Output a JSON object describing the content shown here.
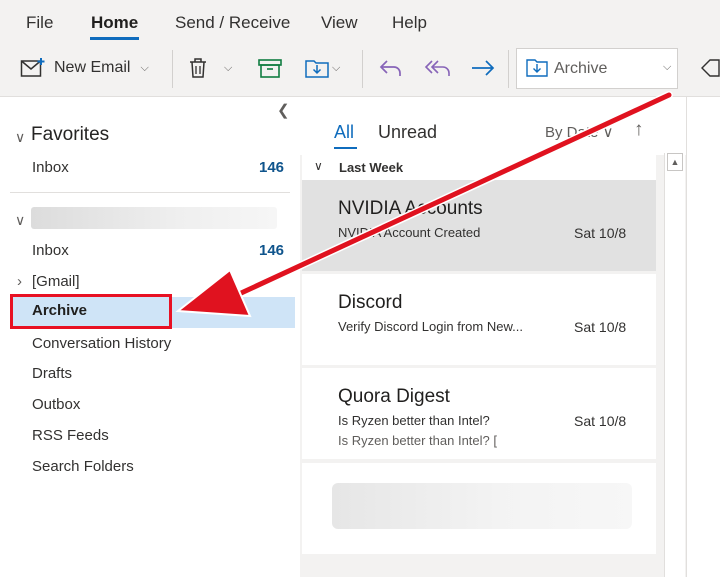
{
  "ribbon": {
    "tabs": [
      {
        "label": "File"
      },
      {
        "label": "Home"
      },
      {
        "label": "Send / Receive"
      },
      {
        "label": "View"
      },
      {
        "label": "Help"
      }
    ],
    "active_tab": "Home",
    "new_email_label": "New Email",
    "quick_step_value": "Archive"
  },
  "folders": {
    "favorites_label": "Favorites",
    "favorites": [
      {
        "label": "Inbox",
        "count": "146"
      }
    ],
    "account": {
      "folders": [
        {
          "label": "Inbox",
          "count": "146"
        },
        {
          "label": "[Gmail]"
        },
        {
          "label": "Archive"
        },
        {
          "label": "Conversation History"
        },
        {
          "label": "Drafts"
        },
        {
          "label": "Outbox"
        },
        {
          "label": "RSS Feeds"
        },
        {
          "label": "Search Folders"
        }
      ]
    }
  },
  "message_list": {
    "filters": [
      {
        "label": "All"
      },
      {
        "label": "Unread"
      }
    ],
    "sort_label": "By Date",
    "group_label": "Last Week",
    "messages": [
      {
        "sender": "NVIDIA Accounts",
        "subject": "NVIDIA Account Created",
        "date": "Sat 10/8",
        "preview": ""
      },
      {
        "sender": "Discord",
        "subject": "Verify Discord Login from New...",
        "date": "Sat 10/8",
        "preview": ""
      },
      {
        "sender": "Quora Digest",
        "subject": "Is Ryzen better than Intel?",
        "date": "Sat 10/8",
        "preview": "Is Ryzen better than Intel? ["
      }
    ]
  },
  "colors": {
    "accent": "#0f6cbd",
    "highlight_box": "#e81123",
    "annotation_arrow": "#e0121f",
    "selected_folder_bg": "#cfe4f7"
  }
}
